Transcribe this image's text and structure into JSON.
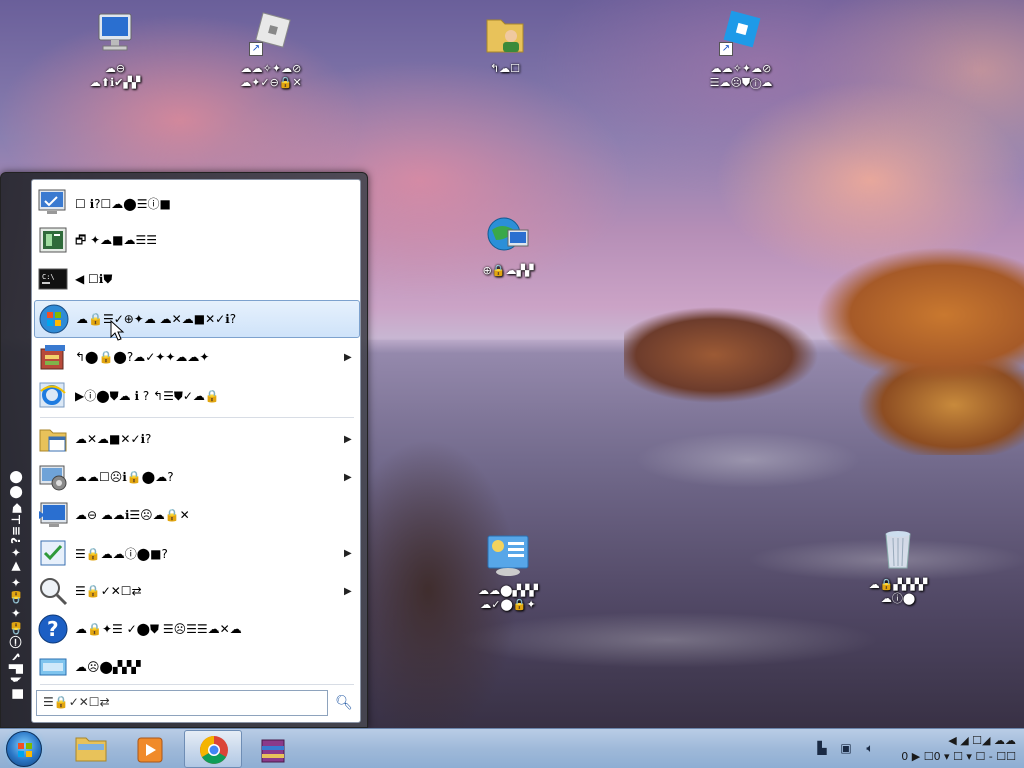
{
  "desktop": {
    "icons": [
      {
        "name": "computer",
        "line1": "☁⊖",
        "line2": "☁⬆ℹ✔▞▞"
      },
      {
        "name": "roblox-studio",
        "line1": "☁☁✧✦☁⊘",
        "line2": "☁✦✓⊖🔒✕"
      },
      {
        "name": "user-folder",
        "line1": "↰☁☐",
        "line2": ""
      },
      {
        "name": "roblox-player",
        "line1": "☁☁✧✦☁⊘",
        "line2": "☰☁☹⛊ⓘ☁"
      },
      {
        "name": "network",
        "line1": "⊕🔒☁▞▞",
        "line2": ""
      },
      {
        "name": "control-panel",
        "line1": "☁☁⬤▞▞▞",
        "line2": "☁✓⬤🔒✦"
      },
      {
        "name": "recycle-bin",
        "line1": "☁🔒▞▞▞▞",
        "line2": "☁ⓘ⬤"
      }
    ]
  },
  "start_menu": {
    "banner": "▆☁▟✔ⓘ🔒✦🔒✦▼✦?≡⊥⛊⬤⬤",
    "items": [
      {
        "name": "system-info",
        "label": "☐ ℹ?☐☁⬤☰ⓘ■",
        "arrow": ""
      },
      {
        "name": "task-manager",
        "label": "🗗 ✦☁■☁☰☰",
        "arrow": ""
      },
      {
        "name": "command-prompt",
        "label": "◀ ☐ℹ⛊",
        "arrow": ""
      },
      {
        "name": "windows-update",
        "label": "☁🔒☰✓⊕✦☁ ☁✕☁■✕✓ℹ?",
        "arrow": ""
      },
      {
        "name": "programs",
        "label": "↰⬤🔒⬤?☁✓✦✦☁☁✦",
        "arrow": "▶"
      },
      {
        "name": "internet-explorer",
        "label": "▶ⓘ⬤⛊☁ ℹ ? ↰☰⛊✓☁🔒",
        "arrow": ""
      },
      {
        "name": "documents",
        "label": "☁✕☁■✕✓ℹ?",
        "arrow": "▶"
      },
      {
        "name": "settings",
        "label": "☁☁☐☹ℹ🔒⬤☁?",
        "arrow": "▶"
      },
      {
        "name": "remote-desktop",
        "label": "☁⊖ ☁☁ℹ☰☹☁🔒✕",
        "arrow": ""
      },
      {
        "name": "tasks",
        "label": "☰🔒☁☁ⓘ⬤■?",
        "arrow": "▶"
      },
      {
        "name": "search",
        "label": "☰🔒✓✕☐⇄",
        "arrow": "▶"
      },
      {
        "name": "help",
        "label": "☁🔒✦☰ ✓⬤⛊ ☰☹☰☰☁✕☁",
        "arrow": ""
      },
      {
        "name": "run",
        "label": "☁☹⬤▞▞▞",
        "arrow": ""
      }
    ],
    "search_box": "☰🔒✓✕☐⇄"
  },
  "taskbar": {
    "apps": [
      {
        "name": "file-explorer",
        "active": false
      },
      {
        "name": "media-player",
        "active": false
      },
      {
        "name": "chrome",
        "active": true
      },
      {
        "name": "winrar",
        "active": false
      }
    ],
    "tray": {
      "time": "◀ ◢ ☐◢ ☁☁",
      "date": "0 ▶ ☐0 ▾ ☐ ▾ ☐ - ☐☐"
    }
  }
}
